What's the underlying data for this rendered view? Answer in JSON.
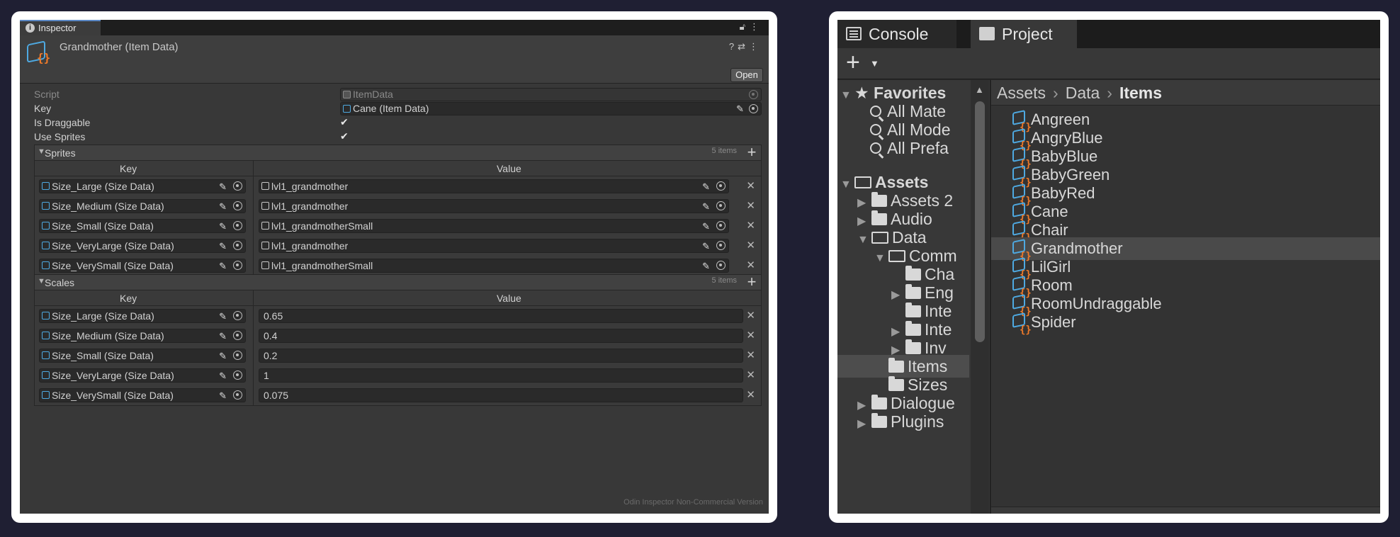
{
  "inspector": {
    "tab_label": "Inspector",
    "title": "Grandmother (Item Data)",
    "open_label": "Open",
    "fields": {
      "script_label": "Script",
      "script_value": "ItemData",
      "key_label": "Key",
      "key_value": "Cane (Item Data)",
      "draggable_label": "Is Draggable",
      "draggable_checked": true,
      "use_sprites_label": "Use Sprites",
      "use_sprites_checked": true
    },
    "sprites": {
      "title": "Sprites",
      "count": "5 items",
      "key_header": "Key",
      "value_header": "Value",
      "entries": [
        {
          "key": "Size_Large (Size Data)",
          "value": "lvl1_grandmother"
        },
        {
          "key": "Size_Medium (Size Data)",
          "value": "lvl1_grandmother"
        },
        {
          "key": "Size_Small (Size Data)",
          "value": "lvl1_grandmotherSmall"
        },
        {
          "key": "Size_VeryLarge (Size Data)",
          "value": "lvl1_grandmother"
        },
        {
          "key": "Size_VerySmall (Size Data)",
          "value": "lvl1_grandmotherSmall"
        }
      ]
    },
    "scales": {
      "title": "Scales",
      "count": "5 items",
      "key_header": "Key",
      "value_header": "Value",
      "entries": [
        {
          "key": "Size_Large (Size Data)",
          "value": "0.65"
        },
        {
          "key": "Size_Medium (Size Data)",
          "value": "0.4"
        },
        {
          "key": "Size_Small (Size Data)",
          "value": "0.2"
        },
        {
          "key": "Size_VeryLarge (Size Data)",
          "value": "1"
        },
        {
          "key": "Size_VerySmall (Size Data)",
          "value": "0.075"
        }
      ]
    },
    "footer": "Odin Inspector Non-Commercial Version"
  },
  "project": {
    "tabs": [
      {
        "label": "Console",
        "icon": "console-icon"
      },
      {
        "label": "Project",
        "icon": "folder-icon"
      }
    ],
    "tree": {
      "favorites_label": "Favorites",
      "favorites": [
        "All Mate",
        "All Mode",
        "All Prefa"
      ],
      "assets_label": "Assets",
      "folders": [
        {
          "label": "Assets 2",
          "expandable": true
        },
        {
          "label": "Audio",
          "expandable": true
        },
        {
          "label": "Data",
          "expanded": true
        },
        {
          "label": "Comm",
          "expanded": true
        },
        {
          "label": "Cha",
          "expandable": false
        },
        {
          "label": "Eng",
          "expandable": true
        },
        {
          "label": "Inte",
          "expandable": false
        },
        {
          "label": "Inte",
          "expandable": true
        },
        {
          "label": "Inv",
          "expandable": true
        },
        {
          "label": "Items",
          "selected": true
        },
        {
          "label": "Sizes",
          "expandable": false
        },
        {
          "label": "Dialogue",
          "expandable": true
        },
        {
          "label": "Plugins",
          "expandable": true
        }
      ]
    },
    "breadcrumb": [
      "Assets",
      "Data",
      "Items"
    ],
    "items": [
      "Angreen",
      "AngryBlue",
      "BabyBlue",
      "BabyGreen",
      "BabyRed",
      "Cane",
      "Chair",
      "Grandmother",
      "LilGirl",
      "Room",
      "RoomUndraggable",
      "Spider"
    ],
    "selected_item": "Grandmother"
  },
  "colors": {
    "background": "#1f1f33",
    "card": "#ffffff",
    "accent_blue": "#4ea9e1",
    "accent_orange": "#f07a29",
    "tab_highlight": "#5a87c4"
  }
}
